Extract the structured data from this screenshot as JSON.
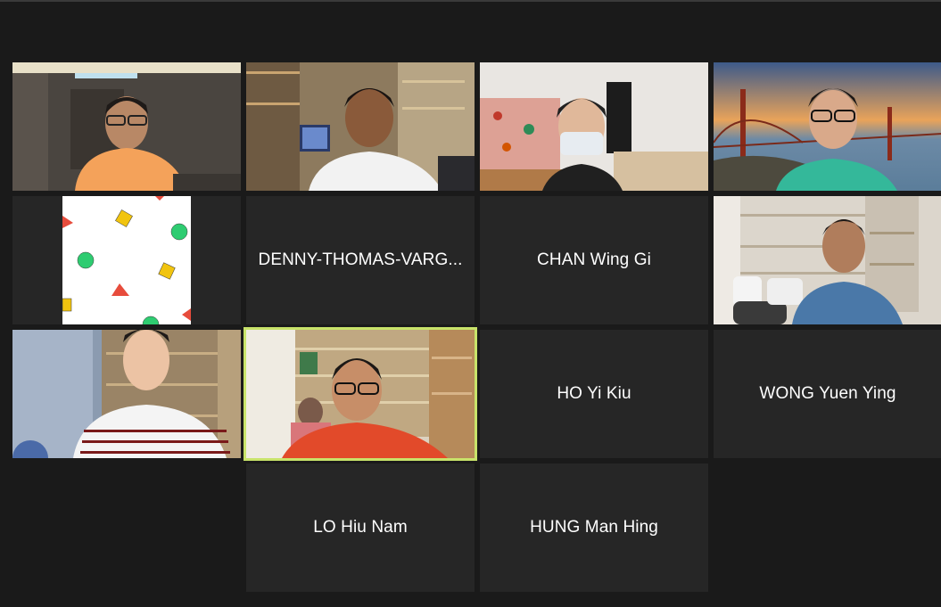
{
  "participants": [
    {
      "id": "p1",
      "has_video": true,
      "scene": "person in orange shirt with glasses, dim room"
    },
    {
      "id": "p2",
      "has_video": true,
      "scene": "person in white shirt, bookshelf and monitor"
    },
    {
      "id": "p3",
      "has_video": true,
      "scene": "person with face mask in bedroom"
    },
    {
      "id": "p4",
      "has_video": true,
      "scene": "person with glasses, golden gate bridge background"
    },
    {
      "id": "p5",
      "has_video": true,
      "scene": "colorful shapes pattern"
    },
    {
      "id": "p6",
      "has_video": false,
      "name": "DENNY-THOMAS-VARG..."
    },
    {
      "id": "p7",
      "has_video": false,
      "name": "CHAN Wing Gi"
    },
    {
      "id": "p8",
      "has_video": true,
      "scene": "person in blue shirt, shelves"
    },
    {
      "id": "p9",
      "has_video": true,
      "scene": "person in striped shirt, shelves"
    },
    {
      "id": "p10",
      "has_video": true,
      "active_speaker": true,
      "scene": "person in red shirt with glasses, bookshelves"
    },
    {
      "id": "p11",
      "has_video": false,
      "name": "HO Yi Kiu"
    },
    {
      "id": "p12",
      "has_video": false,
      "name": "WONG Yuen Ying"
    },
    {
      "id": "p13",
      "has_video": false,
      "name": "LO Hiu Nam"
    },
    {
      "id": "p14",
      "has_video": false,
      "name": "HUNG Man Hing"
    }
  ],
  "colors": {
    "background": "#1a1a1a",
    "tile": "#262626",
    "active_border": "#c8e36a",
    "name_text": "#ffffff"
  }
}
